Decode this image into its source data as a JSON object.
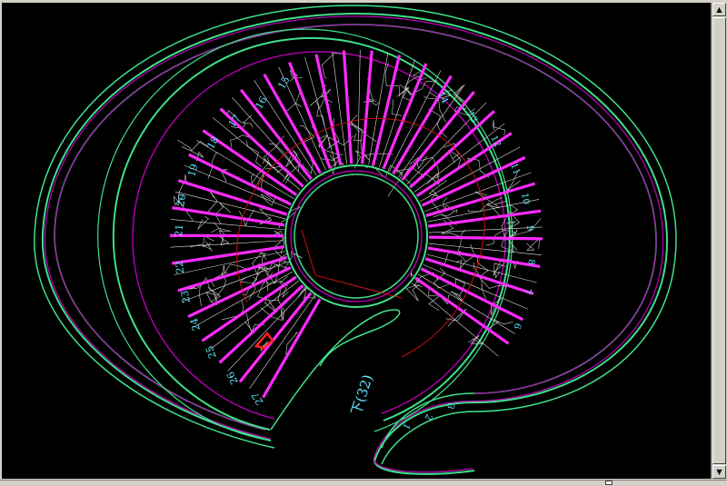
{
  "drawing": {
    "step_labels_left": [
      "15",
      "16",
      "17",
      "18",
      "19",
      "20",
      "21",
      "22",
      "23",
      "24",
      "25",
      "26",
      "27"
    ],
    "step_labels_right": [
      "14",
      "13",
      "12",
      "11",
      "10",
      "9",
      "8",
      "7",
      "6",
      "3",
      "2",
      "1"
    ],
    "down_annotation": "下(32)"
  },
  "colors": {
    "background": "#000000",
    "outline_green": "#3fe08a",
    "wall_magenta": "#c000c0",
    "stair_magenta": "#ff2bff",
    "label_cyan": "#5fe8ff",
    "path_red": "#cc1111",
    "texture_white": "#cfcfcf"
  },
  "scrollbars": {
    "up_icon": "arrow-up-icon",
    "down_icon": "arrow-down-icon"
  }
}
